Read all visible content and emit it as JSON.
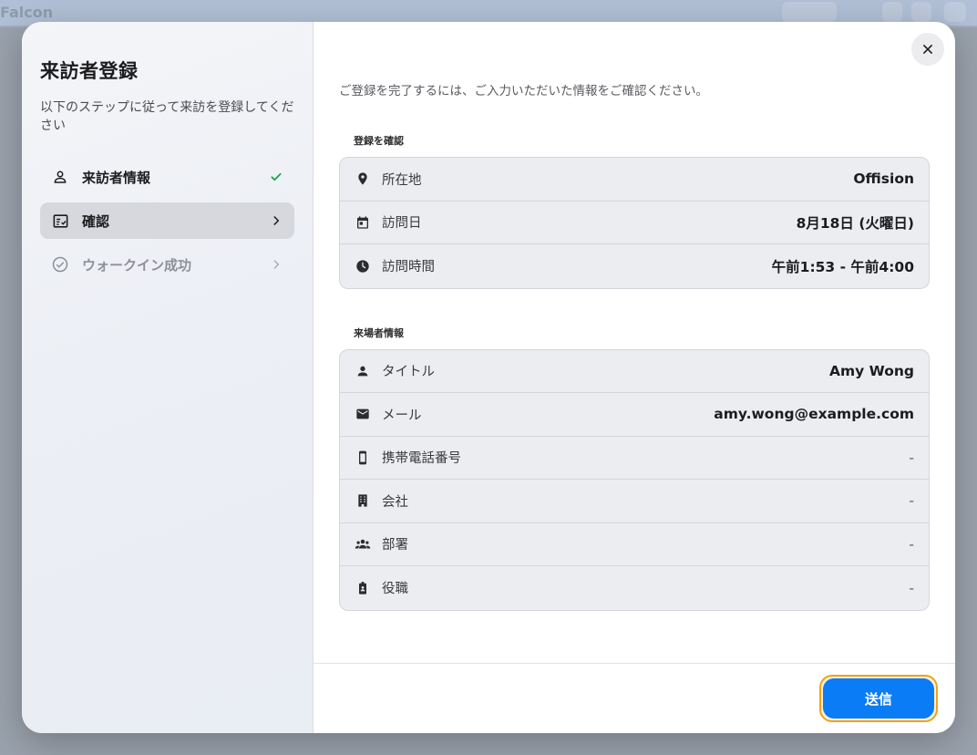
{
  "background": {
    "app_title": "Falcon"
  },
  "sidebar": {
    "title": "来訪者登録",
    "description": "以下のステップに従って来訪を登録してください",
    "steps": [
      {
        "label": "来訪者情報",
        "icon": "person-icon",
        "status": "complete"
      },
      {
        "label": "確認",
        "icon": "checklist-icon",
        "status": "active"
      },
      {
        "label": "ウォークイン成功",
        "icon": "check-circle-icon",
        "status": "disabled"
      }
    ]
  },
  "main": {
    "intro": "ご登録を完了するには、ご入力いただいた情報をご確認ください。",
    "registration": {
      "heading": "登録を確認",
      "rows": [
        {
          "icon": "location-pin-icon",
          "label": "所在地",
          "value": "Offision"
        },
        {
          "icon": "calendar-icon",
          "label": "訪問日",
          "value": "8月18日 (火曜日)"
        },
        {
          "icon": "clock-icon",
          "label": "訪問時間",
          "value": "午前1:53 - 午前4:00"
        }
      ]
    },
    "visitor": {
      "heading": "来場者情報",
      "rows": [
        {
          "icon": "person-icon",
          "label": "タイトル",
          "value": "Amy Wong"
        },
        {
          "icon": "mail-icon",
          "label": "メール",
          "value": "amy.wong@example.com"
        },
        {
          "icon": "phone-icon",
          "label": "携帯電話番号",
          "value": "-"
        },
        {
          "icon": "building-icon",
          "label": "会社",
          "value": "-"
        },
        {
          "icon": "group-icon",
          "label": "部署",
          "value": "-"
        },
        {
          "icon": "badge-icon",
          "label": "役職",
          "value": "-"
        }
      ]
    }
  },
  "footer": {
    "submit_label": "送信"
  },
  "colors": {
    "accent": "#0a7cf5",
    "focus_ring": "#f0a21a",
    "check": "#1aa34a"
  }
}
